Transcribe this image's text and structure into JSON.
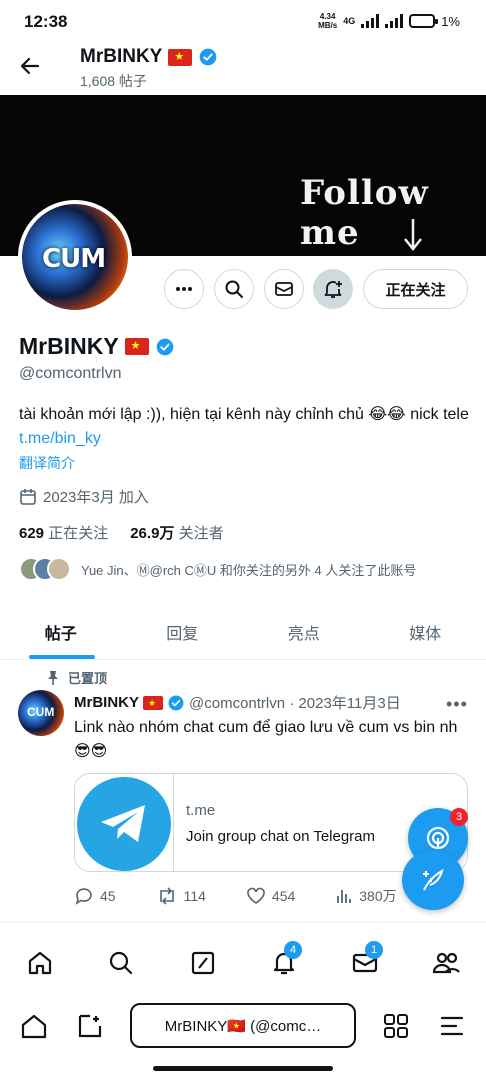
{
  "status_bar": {
    "time": "12:38",
    "net_speed_value": "4.34",
    "net_speed_unit": "MB/s",
    "network": "4G",
    "battery": "1%"
  },
  "header": {
    "name": "MrBINKY",
    "post_count": "1,608 帖子"
  },
  "banner": {
    "text": "Follow me"
  },
  "profile": {
    "avatar_text": "CUM",
    "name": "MrBINKY",
    "handle": "@comcontrlvn",
    "bio_text": "tài khoản mới lập :)), hiện tại kênh này chỉnh chủ 😂😂 nick tele ",
    "bio_link": "t.me/bin_ky",
    "translate": "翻译简介",
    "joined": "2023年3月 加入",
    "following_count": "629",
    "following_label": "正在关注",
    "followers_count": "26.9万",
    "followers_label": "关注者",
    "known_followers": "Yue Jin、Ⓜ@rch CⓂU 和你关注的另外 4 人关注了此账号",
    "follow_button": "正在关注"
  },
  "tabs": [
    {
      "label": "帖子",
      "active": true
    },
    {
      "label": "回复",
      "active": false
    },
    {
      "label": "亮点",
      "active": false
    },
    {
      "label": "媒体",
      "active": false
    }
  ],
  "post": {
    "pinned_label": "已置顶",
    "author": "MrBINKY",
    "avatar_text": "CUM",
    "meta": "@comcontrlvn · 2023年11月3日",
    "text": "Link nào nhóm chat cum để giao lưu về cum vs bin nh 😎😎",
    "card_domain": "t.me",
    "card_title": "Join group chat on Telegram",
    "replies": "45",
    "reposts": "114",
    "likes": "454",
    "views": "380万"
  },
  "fab": {
    "spaces_badge": "3"
  },
  "bottom_nav": {
    "notifications_badge": "4",
    "messages_badge": "1"
  },
  "browser": {
    "url_title": "MrBINKY🇻🇳 (@comc…"
  },
  "colors": {
    "accent": "#1d9bf0",
    "text": "#0f1419",
    "secondary": "#536471",
    "flag_red": "#da251d",
    "badge_red": "#f4212e"
  }
}
